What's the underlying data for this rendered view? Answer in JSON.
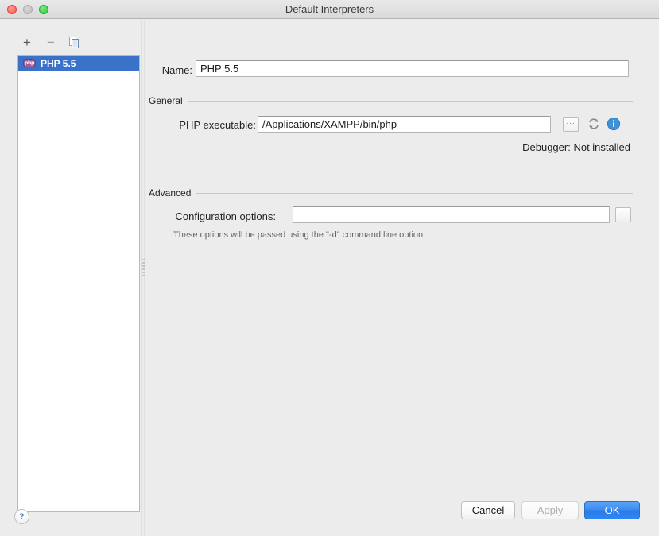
{
  "window": {
    "title": "Default Interpreters",
    "traffic_lights": [
      "close-button",
      "minimize-button",
      "zoom-button"
    ]
  },
  "sidebar": {
    "toolbar": [
      {
        "name": "add-interpreter-button",
        "glyph": "+"
      },
      {
        "name": "remove-interpreter-button",
        "glyph": "−"
      },
      {
        "name": "copy-interpreter-button",
        "glyph": "copy-icon"
      }
    ],
    "items": [
      {
        "label": "PHP 5.5",
        "icon": "php-icon",
        "icon_text": "php",
        "selected": true
      }
    ],
    "selection_color": "#3a72c9"
  },
  "form": {
    "name": {
      "label": "Name:",
      "value": "PHP 5.5",
      "placeholder": ""
    },
    "sections": {
      "general": {
        "title": "General",
        "php_executable": {
          "label": "PHP executable:",
          "value": "/Applications/XAMPP/bin/php",
          "placeholder": "",
          "browse_label": "...",
          "refresh_icon": "refresh-icon",
          "info_icon": "info-icon"
        },
        "debugger": {
          "label": "Debugger:",
          "value": "Not installed"
        }
      },
      "advanced": {
        "title": "Advanced",
        "configuration_options": {
          "label": "Configuration options:",
          "value": "",
          "placeholder": "",
          "browse_label": "..."
        },
        "hint": "These options will be passed using the \"-d\" command line option"
      }
    }
  },
  "footer": {
    "help_label": "?",
    "cancel_label": "Cancel",
    "apply_label": "Apply",
    "ok_label": "OK",
    "ok_color": "#3a8bf0",
    "apply_enabled": false
  }
}
